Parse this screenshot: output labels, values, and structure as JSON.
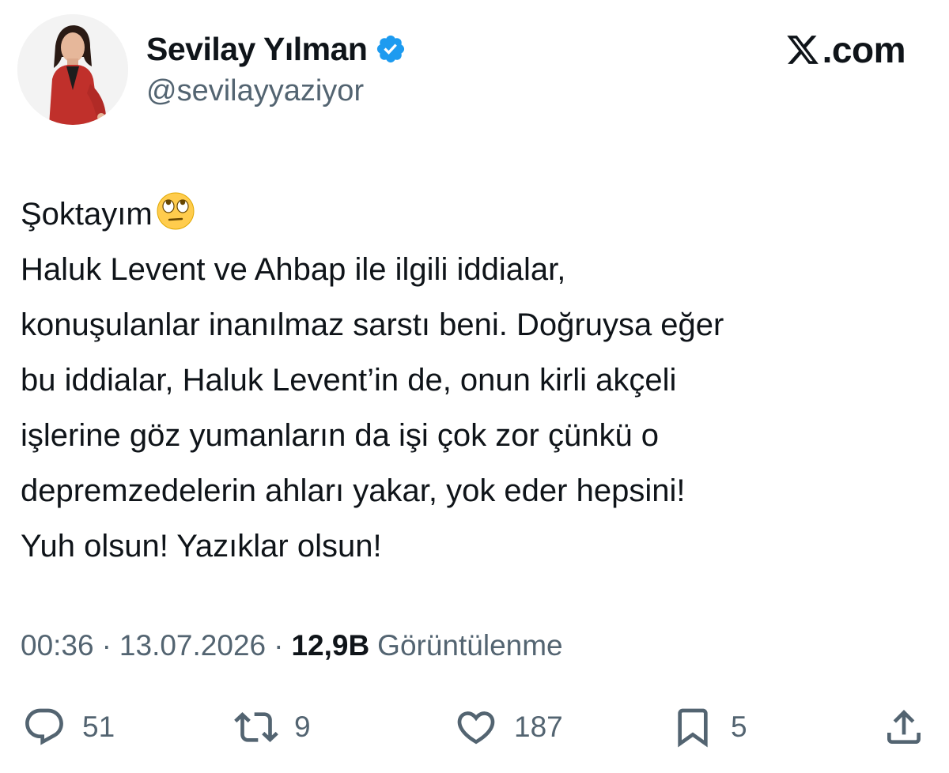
{
  "author": {
    "display_name": "Sevilay Yılman",
    "handle": "@sevilayyaziyor",
    "verified": true,
    "avatar_icon": "profile-photo"
  },
  "source": {
    "label": ".com",
    "logo_icon": "x-logo-icon"
  },
  "tweet": {
    "lines": [
      "Şoktayım",
      "Haluk Levent ve Ahbap ile ilgili iddialar,",
      "konuşulanlar inanılmaz sarstı beni. Doğruysa eğer",
      "bu iddialar, Haluk Levent’in de, onun kirli akçeli",
      "işlerine göz yumanların da işi çok zor çünkü o",
      "depremzedelerin ahları yakar, yok eder hepsini!",
      "Yuh olsun! Yazıklar olsun!"
    ],
    "emoji_icon": "face-with-rolling-eyes-icon"
  },
  "meta": {
    "time": "00:36",
    "date": "13.07.2026",
    "separator": "·",
    "views_count": "12,9B",
    "views_label": "Görüntülenme"
  },
  "actions": {
    "replies": "51",
    "reposts": "9",
    "likes": "187",
    "bookmarks": "5"
  },
  "colors": {
    "text_primary": "#0f1419",
    "text_secondary": "#536471",
    "verified_blue": "#1d9bf0"
  }
}
